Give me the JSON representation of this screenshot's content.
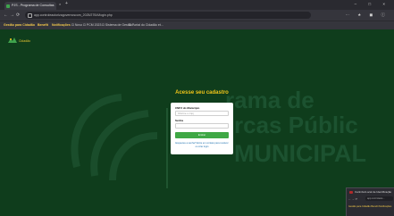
{
  "browser": {
    "tab_title": "PJS - Programa de Consultas",
    "tab_close": "×",
    "new_tab": "+",
    "window_controls": "–  □  ×",
    "nav": {
      "back": "←",
      "forward": "→",
      "reload": "⟳"
    },
    "url": "app.controleautorizagovernoscom_2025/27B/4/login.php",
    "toolbar_icons": "⋯  ★  ◼  ⓘ",
    "bookmarks": [
      {
        "label": "Gestão para Cidadão",
        "color": "#f2c94c"
      },
      {
        "label": "Benefit",
        "color": "#ffcf4a"
      },
      {
        "label": "Notificações",
        "color": "#f2c94c"
      },
      {
        "label": "⊡ Novo",
        "color": "#cfcfcf"
      },
      {
        "label": "⊡ PCM 2023",
        "color": "#cfcfcf"
      },
      {
        "label": "⊡ Sistema de Gestão...",
        "color": "#cfcfcf"
      },
      {
        "label": "⊡ Portal do Cidadão et...",
        "color": "#cfcfcf"
      }
    ]
  },
  "page": {
    "logo_text": "Cidadão",
    "bg_text": {
      "line1": "rama de",
      "line2": "rcas Públic",
      "line3": "MUNICIPAL"
    },
    "login": {
      "title": "Acesse seu cadastro",
      "cpf_label": "CNPJ do Município",
      "cpf_placeholder": "Informe o cnpj",
      "password_label": "Senha",
      "password_placeholder": "",
      "submit_label": "Entrar",
      "help_text": "Esqueceu a senha? Entre em contato para resolver ou criar login"
    }
  },
  "popup": {
    "title": "Carimbo/Local de Identificação",
    "nav": "←  →  ⟳",
    "url": "app.controlesis...",
    "bookmarks": "Gestão para Cidadão  Benefit  Notificações"
  },
  "colors": {
    "page_bg": "#0f3d1c",
    "accent_yellow": "#f0c419",
    "button_green": "#3fa845"
  }
}
